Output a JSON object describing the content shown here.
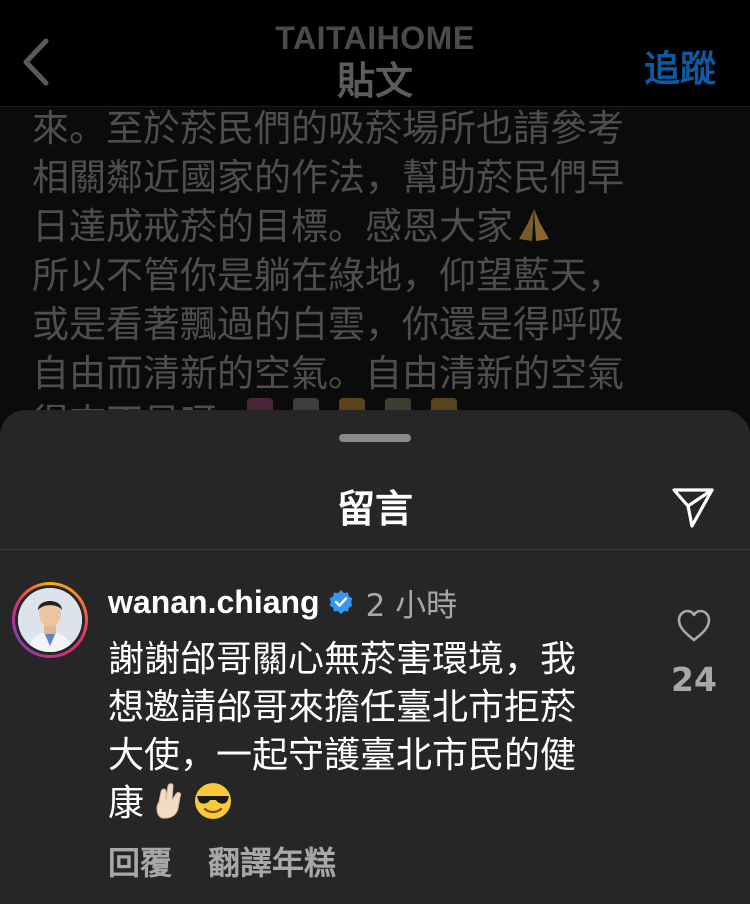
{
  "header": {
    "account_name": "TAITAIHOME",
    "title": "貼文",
    "follow_label": "追蹤",
    "back_icon": "chevron-left-icon"
  },
  "caption": {
    "lines": [
      "來。至於菸民們的吸菸場所也請參考",
      "相關鄰近國家的作法，幫助菸民們早",
      "日達成戒菸的目標。感恩大家",
      "所以不管你是躺在綠地，仰望藍天，",
      "或是看著飄過的白雲，你還是得呼吸",
      "自由而清新的空氣。自由清新的空氣",
      "得來不易呀"
    ],
    "pray_emoji": "folded-hands-icon"
  },
  "comments_sheet": {
    "title": "留言",
    "send_icon": "send-icon",
    "comment": {
      "username": "wanan.chiang",
      "verified_icon": "verified-badge-icon",
      "timestamp": "2 小時",
      "lines": [
        "謝謝邰哥關心無菸害環境，我",
        "想邀請邰哥來擔任臺北市拒菸",
        "大使，一起守護臺北市民的健",
        "康"
      ],
      "emojis": [
        "crossed-fingers-icon",
        "sunglasses-face-icon"
      ],
      "like_icon": "heart-outline-icon",
      "like_count": "24",
      "reply_label": "回覆",
      "translate_label": "翻譯年糕"
    }
  },
  "colors": {
    "background": "#000000",
    "sheet": "#262626",
    "follow": "#0d5aa3",
    "muted_text": "#a8a8a8",
    "verified": "#3797f0"
  }
}
